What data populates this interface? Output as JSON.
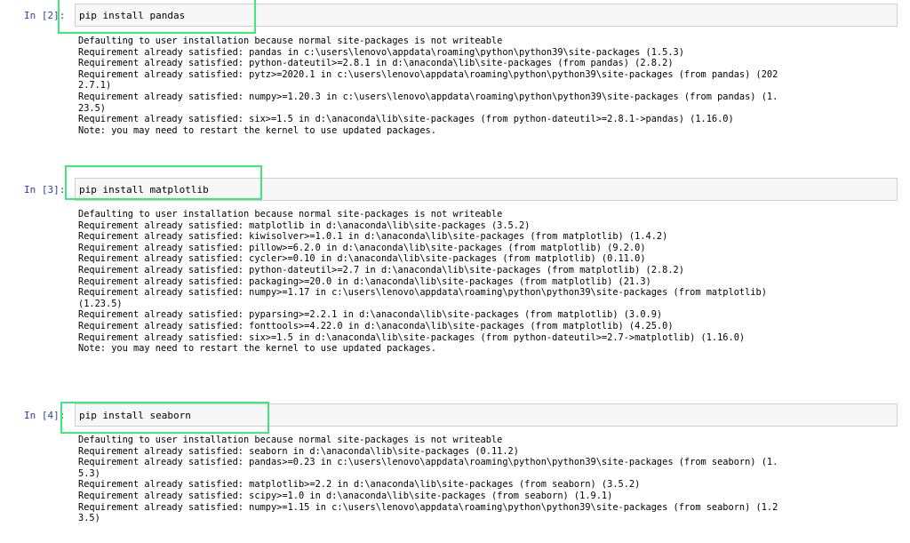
{
  "cells": [
    {
      "prompt": "In [2]:",
      "code": "pip install pandas",
      "output": [
        "Defaulting to user installation because normal site-packages is not writeable",
        "Requirement already satisfied: pandas in c:\\users\\lenovo\\appdata\\roaming\\python\\python39\\site-packages (1.5.3)",
        "Requirement already satisfied: python-dateutil>=2.8.1 in d:\\anaconda\\lib\\site-packages (from pandas) (2.8.2)",
        "Requirement already satisfied: pytz>=2020.1 in c:\\users\\lenovo\\appdata\\roaming\\python\\python39\\site-packages (from pandas) (202",
        "2.7.1)",
        "Requirement already satisfied: numpy>=1.20.3 in c:\\users\\lenovo\\appdata\\roaming\\python\\python39\\site-packages (from pandas) (1.",
        "23.5)",
        "Requirement already satisfied: six>=1.5 in d:\\anaconda\\lib\\site-packages (from python-dateutil>=2.8.1->pandas) (1.16.0)",
        "Note: you may need to restart the kernel to use updated packages."
      ]
    },
    {
      "prompt": "In [3]:",
      "code": "pip install matplotlib",
      "output": [
        "Defaulting to user installation because normal site-packages is not writeable",
        "Requirement already satisfied: matplotlib in d:\\anaconda\\lib\\site-packages (3.5.2)",
        "Requirement already satisfied: kiwisolver>=1.0.1 in d:\\anaconda\\lib\\site-packages (from matplotlib) (1.4.2)",
        "Requirement already satisfied: pillow>=6.2.0 in d:\\anaconda\\lib\\site-packages (from matplotlib) (9.2.0)",
        "Requirement already satisfied: cycler>=0.10 in d:\\anaconda\\lib\\site-packages (from matplotlib) (0.11.0)",
        "Requirement already satisfied: python-dateutil>=2.7 in d:\\anaconda\\lib\\site-packages (from matplotlib) (2.8.2)",
        "Requirement already satisfied: packaging>=20.0 in d:\\anaconda\\lib\\site-packages (from matplotlib) (21.3)",
        "Requirement already satisfied: numpy>=1.17 in c:\\users\\lenovo\\appdata\\roaming\\python\\python39\\site-packages (from matplotlib)",
        "(1.23.5)",
        "Requirement already satisfied: pyparsing>=2.2.1 in d:\\anaconda\\lib\\site-packages (from matplotlib) (3.0.9)",
        "Requirement already satisfied: fonttools>=4.22.0 in d:\\anaconda\\lib\\site-packages (from matplotlib) (4.25.0)",
        "Requirement already satisfied: six>=1.5 in d:\\anaconda\\lib\\site-packages (from python-dateutil>=2.7->matplotlib) (1.16.0)",
        "Note: you may need to restart the kernel to use updated packages."
      ]
    },
    {
      "prompt": "In [4]:",
      "code": "pip install seaborn",
      "output": [
        "Defaulting to user installation because normal site-packages is not writeable",
        "Requirement already satisfied: seaborn in d:\\anaconda\\lib\\site-packages (0.11.2)",
        "Requirement already satisfied: pandas>=0.23 in c:\\users\\lenovo\\appdata\\roaming\\python\\python39\\site-packages (from seaborn) (1.",
        "5.3)",
        "Requirement already satisfied: matplotlib>=2.2 in d:\\anaconda\\lib\\site-packages (from seaborn) (3.5.2)",
        "Requirement already satisfied: scipy>=1.0 in d:\\anaconda\\lib\\site-packages (from seaborn) (1.9.1)",
        "Requirement already satisfied: numpy>=1.15 in c:\\users\\lenovo\\appdata\\roaming\\python\\python39\\site-packages (from seaborn) (1.2",
        "3.5)"
      ]
    }
  ],
  "colors": {
    "prompt": "#303f9f",
    "highlight": "#3ee87b",
    "input_bg": "#f7f7f7",
    "input_border": "#cfcfcf"
  }
}
